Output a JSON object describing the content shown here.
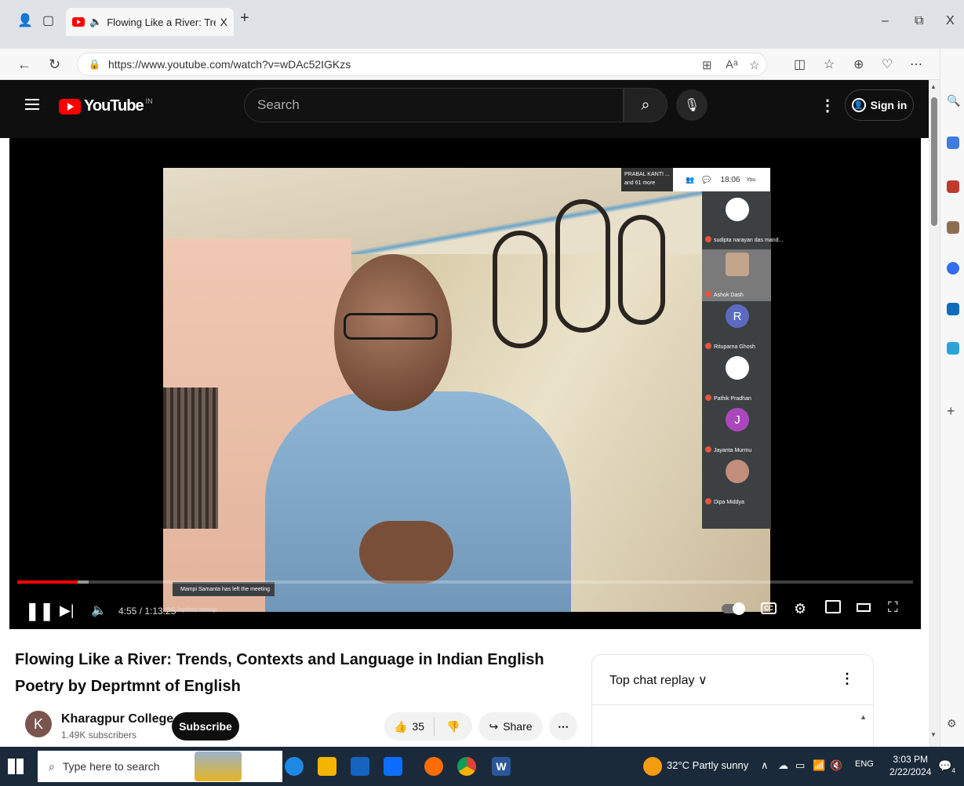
{
  "browser": {
    "tab_title": "Flowing Like a River: Trends,",
    "tab_close": "X",
    "new_tab": "+",
    "url": "https://www.youtube.com/watch?v=wDAc52IGKzs",
    "win_min": "–",
    "win_restore": "⧉",
    "win_close": "X"
  },
  "youtube": {
    "logo_text": "YouTube",
    "country": "IN",
    "search_placeholder": "Search",
    "sign_in": "Sign in"
  },
  "player": {
    "time": "4:55 / 1:13:25",
    "progress_fraction": 0.067,
    "overlay_toast": "Mampi Samanta has left the meeting",
    "overlay_caption": "Jaydeep sarangi",
    "meet_time": "18:06",
    "meet_participants": "PRABAL KANTI ... and 61 more",
    "meet_you": "You",
    "tiles": [
      {
        "name": "sudipta narayan das mand...",
        "initial": "",
        "color": "#3c4043"
      },
      {
        "name": "Ashok Dash",
        "initial": "",
        "color": "#3c4043"
      },
      {
        "name": "Rituparna Ghosh",
        "initial": "R",
        "color": "#5c6bc0"
      },
      {
        "name": "Pathik Pradhan",
        "initial": "",
        "color": "#3c4043"
      },
      {
        "name": "Jayanta Murmu",
        "initial": "J",
        "color": "#ab47bc"
      },
      {
        "name": "Dipa Middya",
        "initial": "",
        "color": "#3c4043"
      }
    ]
  },
  "video": {
    "title": "Flowing Like a River: Trends, Contexts and Language in Indian English Poetry by Deprtmnt of English",
    "channel": "Kharagpur College",
    "channel_initial": "K",
    "subscribers": "1.49K subscribers",
    "subscribe": "Subscribe",
    "likes": "35",
    "share": "Share"
  },
  "chat": {
    "header": "Top chat replay ∨"
  },
  "taskbar": {
    "search_placeholder": "Type here to search",
    "weather": "32°C  Partly sunny",
    "language": "ENG",
    "time": "3:03 PM",
    "date": "2/22/2024",
    "notification_count": "4"
  }
}
